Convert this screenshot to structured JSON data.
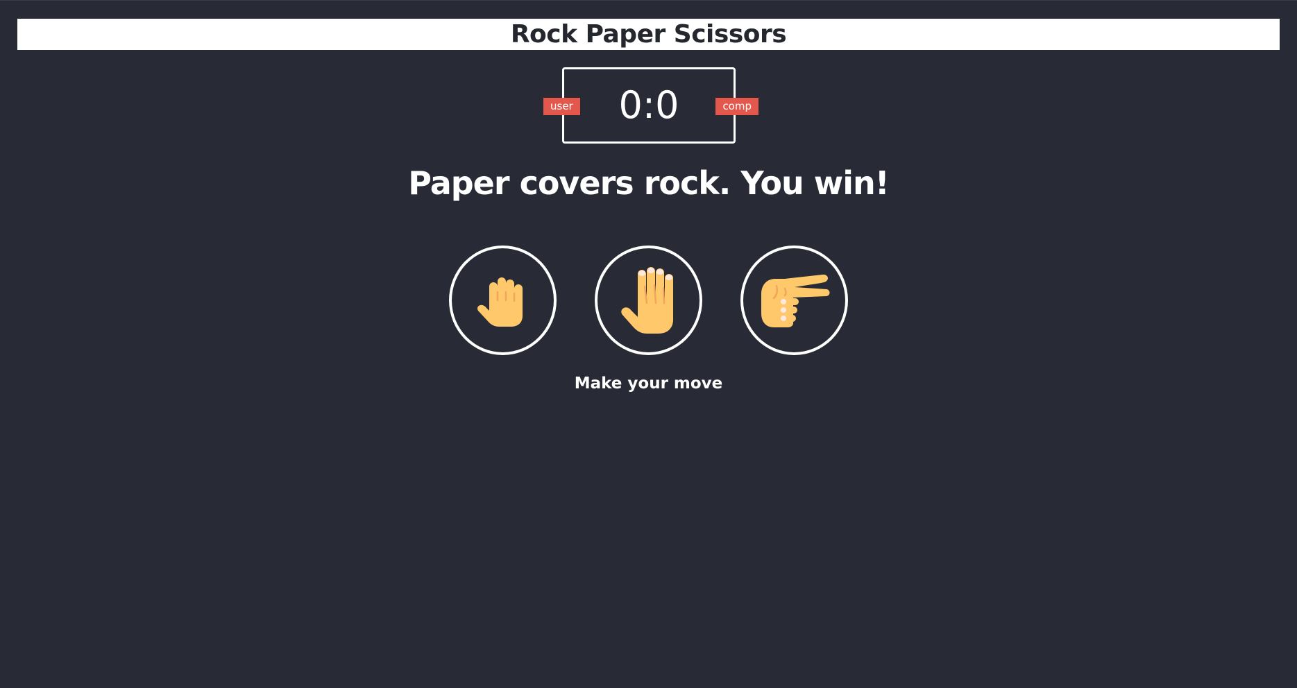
{
  "header": {
    "title": "Rock Paper Scissors"
  },
  "scoreboard": {
    "score": "0:0",
    "user_label": "user",
    "comp_label": "comp"
  },
  "result": {
    "message": "Paper covers rock. You win!"
  },
  "choices": [
    {
      "id": "rock",
      "icon": "fist-icon"
    },
    {
      "id": "paper",
      "icon": "open-hand-icon"
    },
    {
      "id": "scissors",
      "icon": "victory-hand-icon"
    }
  ],
  "action": {
    "message": "Make your move"
  },
  "colors": {
    "background": "#282b35",
    "header_bg": "#ffffff",
    "badge": "#e2584d",
    "skin": "#ffc96b",
    "skin_shadow": "#f2a55b"
  }
}
